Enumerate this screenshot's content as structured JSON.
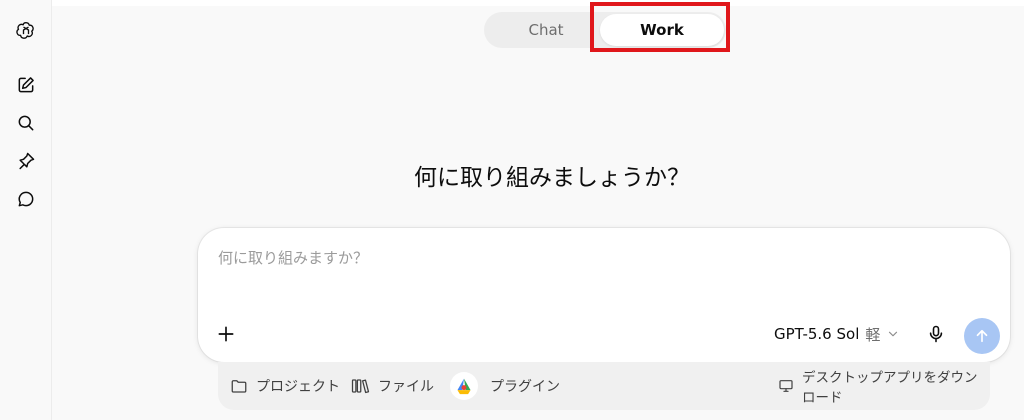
{
  "sidebar": {
    "items": [
      {
        "name": "logo-icon"
      },
      {
        "name": "new-chat-icon"
      },
      {
        "name": "search-icon"
      },
      {
        "name": "pin-icon"
      },
      {
        "name": "chat-bubble-icon"
      }
    ]
  },
  "mode_toggle": {
    "tabs": [
      {
        "label": "Chat",
        "active": false
      },
      {
        "label": "Work",
        "active": true
      }
    ],
    "highlight_color": "#e0171b"
  },
  "main": {
    "heading": "何に取り組みましょうか？"
  },
  "composer": {
    "placeholder": "何に取り組みますか？",
    "value": "",
    "model_label": "GPT-5.6 Sol",
    "model_suffix": "軽",
    "send_color": "#a8c6f4"
  },
  "bottom_bar": {
    "project_label": "プロジェクト",
    "file_label": "ファイル",
    "plugin_label": "プラグイン",
    "download_label": "デスクトップアプリをダウンロード"
  }
}
